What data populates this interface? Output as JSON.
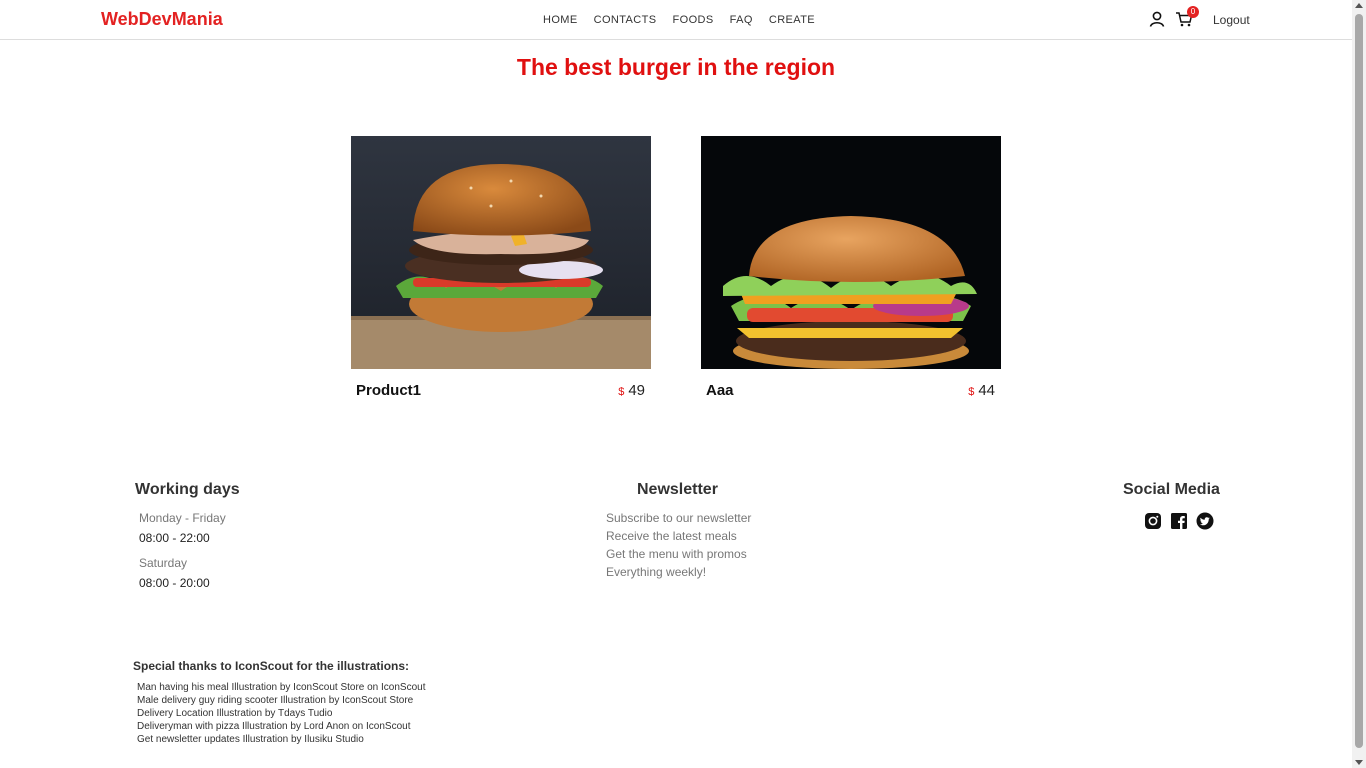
{
  "nav": {
    "brand": "WebDevMania",
    "links": [
      "HOME",
      "CONTACTS",
      "FOODS",
      "FAQ",
      "CREATE"
    ],
    "cart_count": "0",
    "logout": "Logout"
  },
  "headline": "The best burger in the region",
  "products": [
    {
      "name": "Product1",
      "currency": "$",
      "price": "49"
    },
    {
      "name": "Aaa",
      "currency": "$",
      "price": "44"
    }
  ],
  "footer": {
    "working": {
      "title": "Working days",
      "weekdays_label": "Monday - Friday",
      "weekdays_hours": "08:00 - 22:00",
      "saturday_label": "Saturday",
      "saturday_hours": "08:00 - 20:00"
    },
    "newsletter": {
      "title": "Newsletter",
      "lines": [
        "Subscribe to our newsletter",
        "Receive the latest meals",
        "Get the menu with promos",
        "Everything weekly!"
      ]
    },
    "social": {
      "title": "Social Media",
      "icons": [
        "instagram-icon",
        "facebook-icon",
        "twitter-icon"
      ]
    },
    "thanks": {
      "title": "Special thanks to IconScout for the illustrations:",
      "credits": [
        "Man having his meal Illustration by IconScout Store on IconScout",
        "Male delivery guy riding scooter Illustration by IconScout Store",
        "Delivery Location Illustration by Tdays Tudio",
        "Deliveryman with pizza Illustration by Lord Anon on IconScout",
        "Get newsletter updates Illustration by Ilusiku Studio"
      ]
    }
  },
  "colors": {
    "accent": "#e32222",
    "text": "#222222",
    "muted": "#777777"
  }
}
